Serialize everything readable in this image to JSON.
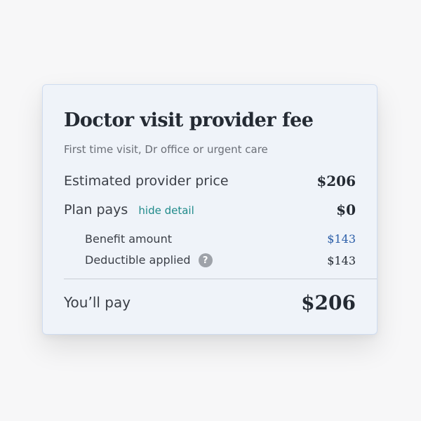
{
  "card": {
    "title": "Doctor visit provider fee",
    "subtitle": "First time visit, Dr office or urgent care",
    "estimated": {
      "label": "Estimated provider price",
      "amount": "$206"
    },
    "plan": {
      "label": "Plan pays",
      "toggle_label": "hide detail",
      "amount": "$0"
    },
    "details": {
      "benefit": {
        "label": "Benefit amount",
        "amount": "$143"
      },
      "deductible": {
        "label": "Deductible applied",
        "help_symbol": "?",
        "amount": "$143"
      }
    },
    "total": {
      "label": "You’ll pay",
      "amount": "$206"
    }
  },
  "colors": {
    "card_background": "#eff3f9",
    "card_border": "#cfdcf0",
    "link": "#1f8a8a",
    "benefit_amount": "#2b5ea8",
    "help_icon": "#9ea2a9"
  }
}
